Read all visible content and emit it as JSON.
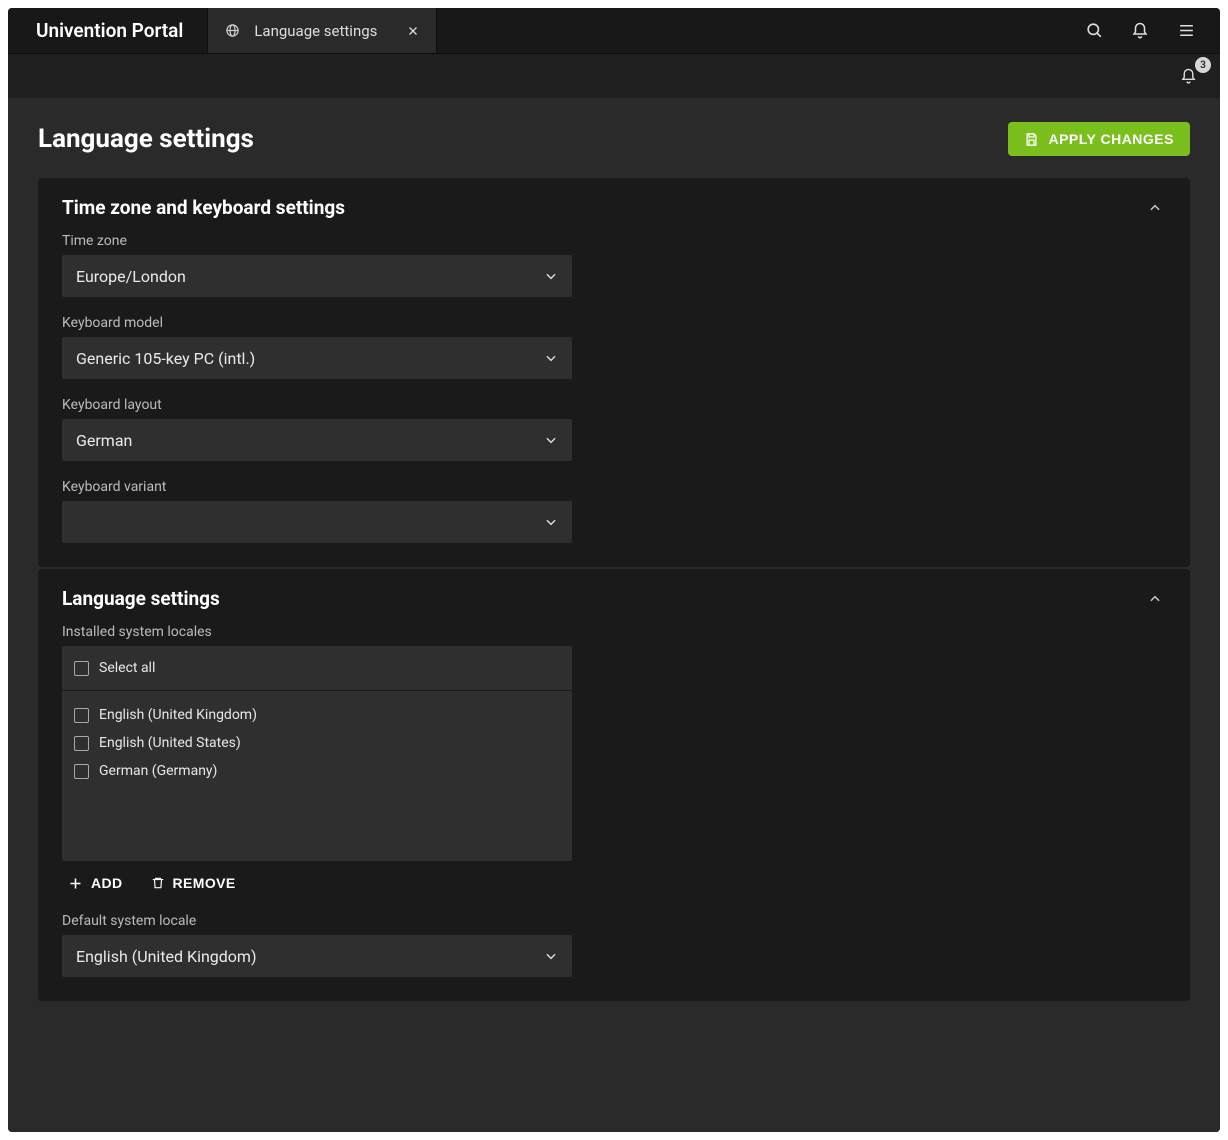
{
  "brand": "Univention Portal",
  "tab": {
    "label": "Language settings"
  },
  "subbar": {
    "notification_count": "3"
  },
  "page": {
    "title": "Language settings",
    "apply_label": "APPLY CHANGES"
  },
  "section_tz": {
    "title": "Time zone and keyboard settings",
    "fields": {
      "timezone_label": "Time zone",
      "timezone_value": "Europe/London",
      "kbmodel_label": "Keyboard model",
      "kbmodel_value": "Generic 105-key PC (intl.)",
      "kblayout_label": "Keyboard layout",
      "kblayout_value": "German",
      "kbvariant_label": "Keyboard variant",
      "kbvariant_value": ""
    }
  },
  "section_lang": {
    "title": "Language settings",
    "installed_label": "Installed system locales",
    "select_all_label": "Select all",
    "locales": [
      "English (United Kingdom)",
      "English (United States)",
      "German (Germany)"
    ],
    "add_label": "ADD",
    "remove_label": "REMOVE",
    "default_label": "Default system locale",
    "default_value": "English (United Kingdom)"
  }
}
